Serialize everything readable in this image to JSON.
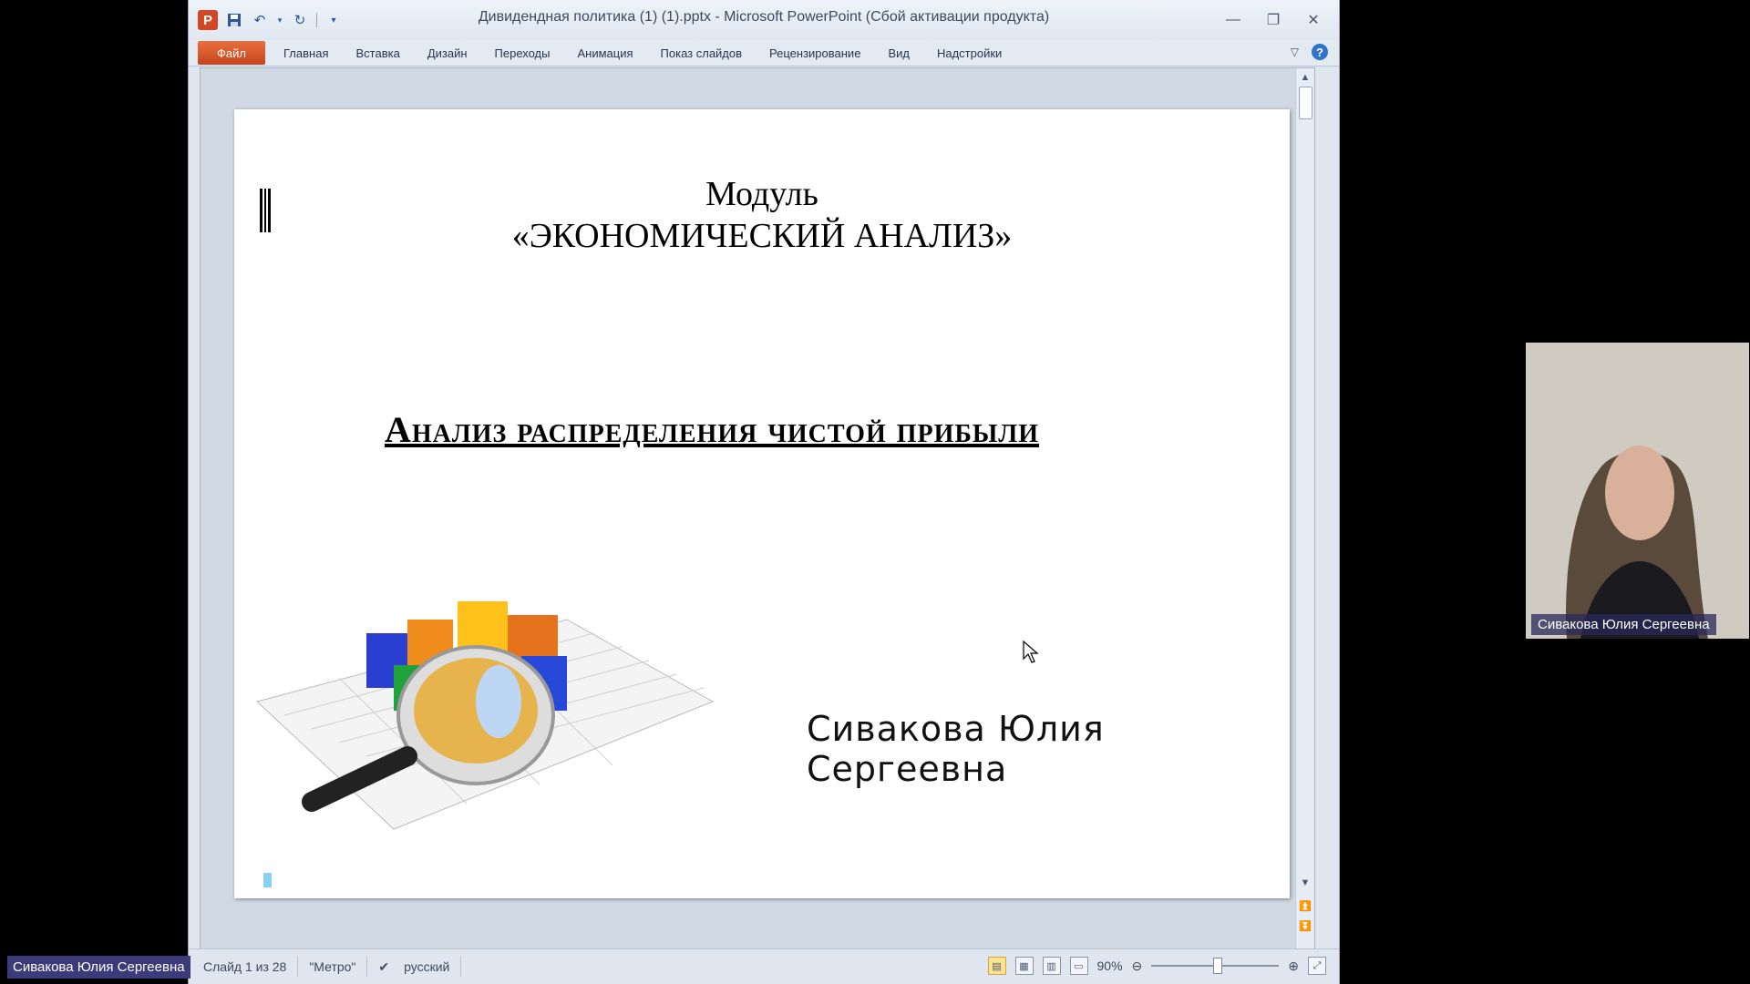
{
  "window": {
    "title": "Дивидендная политика (1) (1).pptx - Microsoft PowerPoint (Сбой активации продукта)",
    "app_icon_letter": "P"
  },
  "ribbon": {
    "file_tab": "Файл",
    "tabs": [
      "Главная",
      "Вставка",
      "Дизайн",
      "Переходы",
      "Анимация",
      "Показ слайдов",
      "Рецензирование",
      "Вид",
      "Надстройки"
    ]
  },
  "slide": {
    "title_line1": "Модуль",
    "title_line2": "«ЭКОНОМИЧЕСКИЙ АНАЛИЗ»",
    "subtitle": "Анализ распределения чистой прибыли",
    "author": "Сивакова Юлия  Сергеевна"
  },
  "status": {
    "slide_counter": "Слайд 1 из 28",
    "theme": "\"Метро\"",
    "language": "русский",
    "zoom": "90%"
  },
  "webcam": {
    "name": "Сивакова Юлия Сергеевна"
  },
  "participant_label": "Сивакова Юлия Сергеевна"
}
